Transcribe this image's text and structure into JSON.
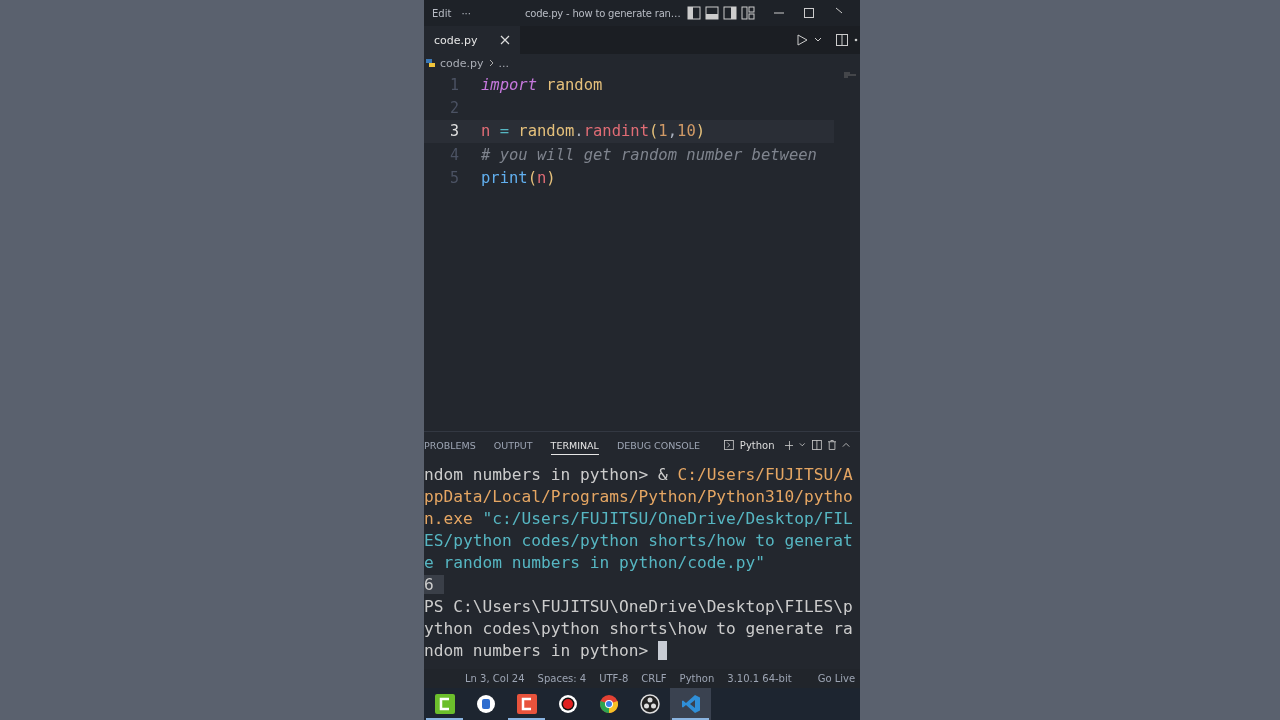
{
  "title_bar": {
    "menu": "Edit",
    "more": "···",
    "title": "code.py - how to generate ran…"
  },
  "editor_tab": {
    "label": "code.py",
    "selected": true
  },
  "breadcrumb": {
    "file": "code.py",
    "rest": "..."
  },
  "code_lines": [
    {
      "number": "1",
      "active": false,
      "tokens": [
        {
          "text": "import",
          "kind": "keyword"
        },
        {
          "text": " random",
          "kind": "module"
        }
      ]
    },
    {
      "number": "2",
      "active": false
    },
    {
      "number": "3",
      "active": true,
      "tokens": [
        {
          "text": "n",
          "kind": "variable"
        },
        {
          "text": " = ",
          "kind": "operator"
        },
        {
          "text": "random",
          "kind": "module"
        },
        {
          "text": ".",
          "kind": "plain"
        },
        {
          "text": "randint",
          "kind": "method"
        },
        {
          "text": "(",
          "kind": "paren"
        },
        {
          "text": "1",
          "kind": "number"
        },
        {
          "text": ",",
          "kind": "plain"
        },
        {
          "text": "10",
          "kind": "number"
        },
        {
          "text": ")",
          "kind": "paren"
        }
      ]
    },
    {
      "number": "4",
      "active": false,
      "tokens": [
        {
          "text": "# you will get random number between",
          "kind": "comment"
        }
      ]
    },
    {
      "number": "5",
      "active": false,
      "tokens": [
        {
          "text": "print",
          "kind": "builtin"
        },
        {
          "text": "(",
          "kind": "paren"
        },
        {
          "text": "n",
          "kind": "variable"
        },
        {
          "text": ")",
          "kind": "paren"
        }
      ]
    }
  ],
  "panel_tabs": [
    {
      "label": "PROBLEMS",
      "selected": false
    },
    {
      "label": "OUTPUT",
      "selected": false
    },
    {
      "label": "TERMINAL",
      "selected": true
    },
    {
      "label": "DEBUG CONSOLE",
      "selected": false
    }
  ],
  "terminal_profile": "Python",
  "terminal_lines": [
    {
      "segments": [
        {
          "text": "ndom numbers in python> & ",
          "kind": "plain"
        },
        {
          "text": "C:/Users/FUJITSU/A",
          "kind": "path"
        }
      ]
    },
    {
      "segments": [
        {
          "text": "ppData/Local/Programs/Python/Python310/pytho",
          "kind": "path"
        }
      ]
    },
    {
      "segments": [
        {
          "text": "n.exe",
          "kind": "path"
        },
        {
          "text": " \"c:/Users/FUJITSU/OneDrive/Desktop/FIL",
          "kind": "string"
        }
      ]
    },
    {
      "segments": [
        {
          "text": "ES/python codes/python shorts/how to generat",
          "kind": "string"
        }
      ]
    },
    {
      "segments": [
        {
          "text": "e random numbers in python/code.py\"",
          "kind": "string"
        }
      ]
    },
    {
      "segments": [
        {
          "text": "6",
          "kind": "output"
        }
      ]
    },
    {
      "segments": [
        {
          "text": "PS C:\\Users\\FUJITSU\\OneDrive\\Desktop\\FILES\\p",
          "kind": "plain"
        }
      ]
    },
    {
      "segments": [
        {
          "text": "ython codes\\python shorts\\how to generate ra",
          "kind": "plain"
        }
      ]
    },
    {
      "segments": [
        {
          "text": "ndom numbers in python>",
          "kind": "plain"
        }
      ],
      "cursor": true
    }
  ],
  "status_bar": [
    "Ln 3, Col 24",
    "Spaces: 4",
    "UTF-8",
    "CRLF",
    "Python",
    "3.10.1 64-bit"
  ],
  "go_live": "Go Live",
  "taskbar": [
    {
      "kind": "green-app",
      "running": true,
      "active": false
    },
    {
      "kind": "paint",
      "running": false,
      "active": false
    },
    {
      "kind": "red-app",
      "running": true,
      "active": false
    },
    {
      "kind": "record",
      "running": false,
      "active": false
    },
    {
      "kind": "chrome",
      "running": false,
      "active": false
    },
    {
      "kind": "obs",
      "running": false,
      "active": false
    },
    {
      "kind": "vscode",
      "running": true,
      "active": true
    }
  ]
}
